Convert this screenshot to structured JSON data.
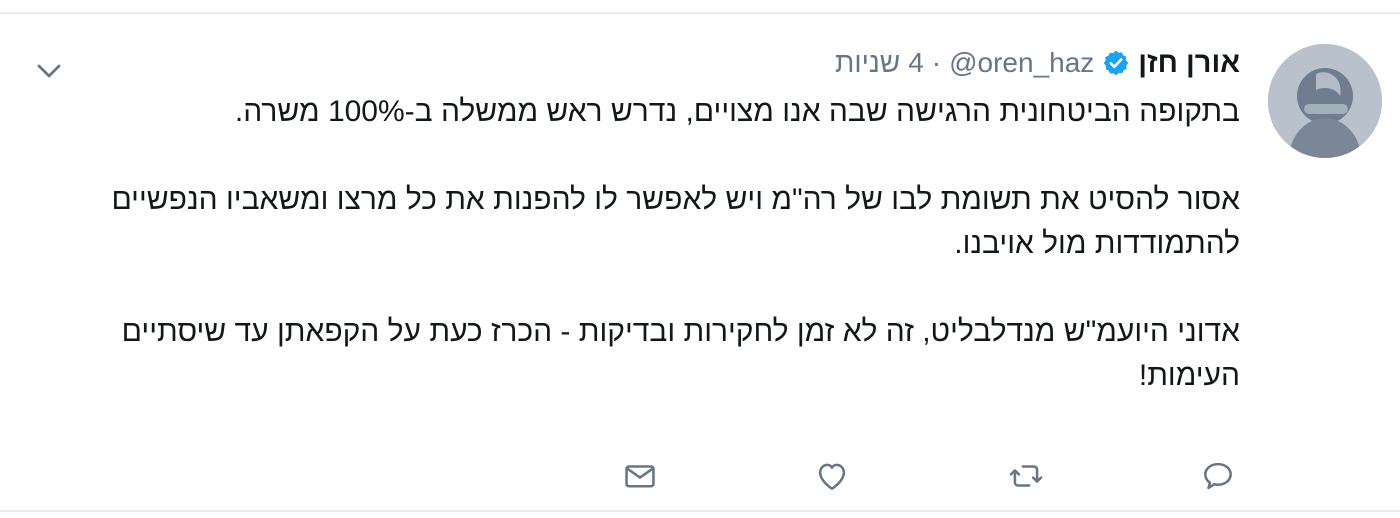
{
  "tweet": {
    "author_name": "אורן חזן",
    "handle": "@oren_haz",
    "separator": "·",
    "time_value": "4",
    "time_unit": "שניות",
    "paragraphs": [
      "בתקופה הביטחונית הרגישה שבה אנו מצויים, נדרש ראש ממשלה ב-100% משרה.",
      "אסור להסיט את תשומת לבו של רה\"מ ויש לאפשר לו להפנות את כל מרצו ומשאביו הנפשיים להתמודדות מול אויבנו.",
      "אדוני היועמ\"ש מנדלבליט, זה לא זמן לחקירות ובדיקות - הכרז כעת על הקפאתן עד שיסתיים העימות!"
    ]
  },
  "icons": {
    "verified": "verified-badge-icon",
    "caret": "chevron-down-icon",
    "reply": "reply-icon",
    "retweet": "retweet-icon",
    "like": "heart-icon",
    "dm": "envelope-icon"
  },
  "colors": {
    "text_primary": "#14171a",
    "text_secondary": "#657786",
    "verified_blue": "#1da1f2",
    "divider": "#e6ecf0"
  }
}
